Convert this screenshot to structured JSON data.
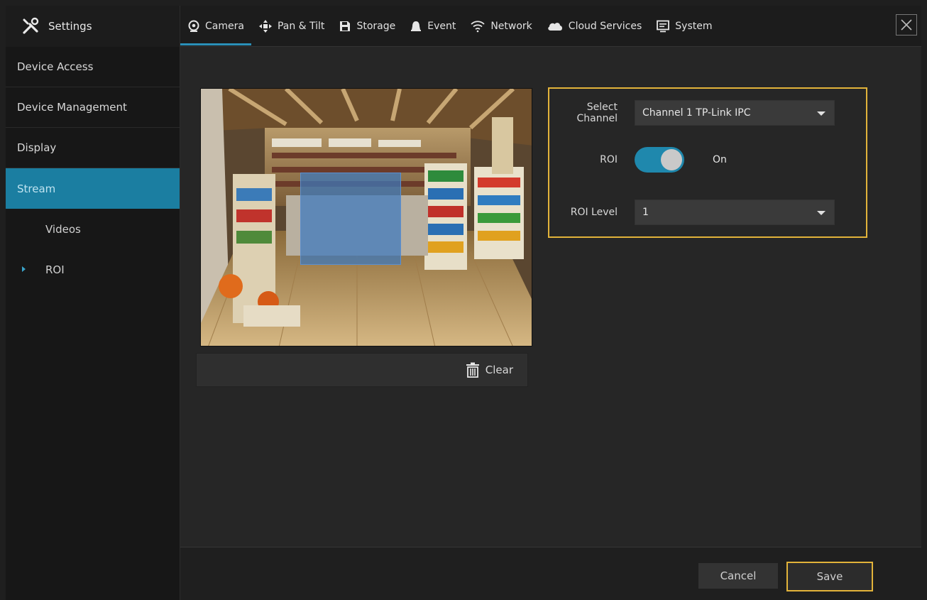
{
  "header": {
    "brand_label": "Settings",
    "brand_icon": "tools-icon",
    "tabs": [
      {
        "label": "Camera",
        "icon": "camera-icon",
        "active": true
      },
      {
        "label": "Pan & Tilt",
        "icon": "pan-tilt-icon",
        "active": false
      },
      {
        "label": "Storage",
        "icon": "storage-icon",
        "active": false
      },
      {
        "label": "Event",
        "icon": "bell-icon",
        "active": false
      },
      {
        "label": "Network",
        "icon": "wifi-icon",
        "active": false
      },
      {
        "label": "Cloud Services",
        "icon": "cloud-icon",
        "active": false
      },
      {
        "label": "System",
        "icon": "monitor-icon",
        "active": false
      }
    ],
    "close_icon": "close-icon"
  },
  "sidebar": {
    "items": [
      {
        "label": "Device Access"
      },
      {
        "label": "Device Management"
      },
      {
        "label": "Display"
      },
      {
        "label": "Stream",
        "active": true
      }
    ],
    "sub_items": [
      {
        "label": "Videos"
      },
      {
        "label": "ROI",
        "current": true
      }
    ]
  },
  "preview": {
    "clear_label": "Clear"
  },
  "form": {
    "channel_label": "Select Channel",
    "channel_value": "Channel 1 TP-Link IPC",
    "roi_label": "ROI",
    "roi_state": "On",
    "roi_level_label": "ROI Level",
    "roi_level_value": "1"
  },
  "footer": {
    "cancel_label": "Cancel",
    "save_label": "Save"
  },
  "colors": {
    "accent": "#1b7ea1",
    "highlight": "#e2b33a",
    "roi_overlay": "#3c78be"
  }
}
